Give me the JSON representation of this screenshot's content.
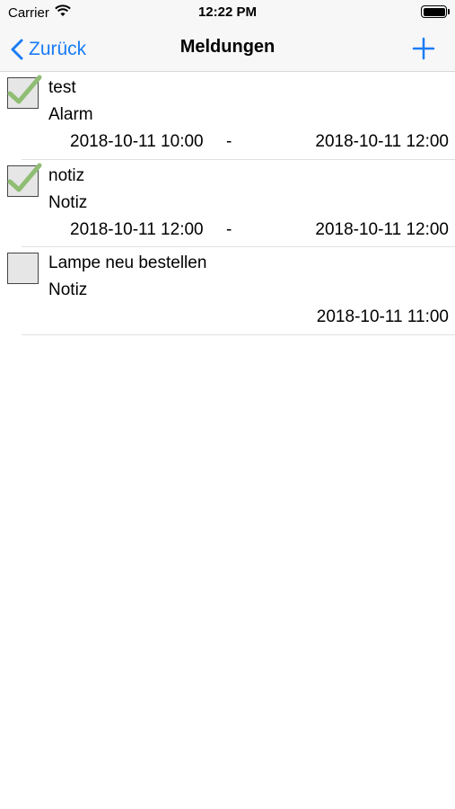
{
  "status_bar": {
    "carrier": "Carrier",
    "time": "12:22 PM"
  },
  "nav": {
    "back_label": "Zurück",
    "title": "Meldungen",
    "accent_color": "#1a7cf5"
  },
  "items": [
    {
      "checked": true,
      "title": "test",
      "type": "Alarm",
      "start": "2018-10-11 10:00",
      "separator": "-",
      "end": "2018-10-11 12:00"
    },
    {
      "checked": true,
      "title": "notiz",
      "type": "Notiz",
      "start": "2018-10-11 12:00",
      "separator": "-",
      "end": "2018-10-11 12:00"
    },
    {
      "checked": false,
      "title": "Lampe neu bestellen",
      "type": "Notiz",
      "start": "",
      "separator": "",
      "end": "2018-10-11 11:00"
    }
  ],
  "colors": {
    "checkmark": "#8fbd73"
  }
}
